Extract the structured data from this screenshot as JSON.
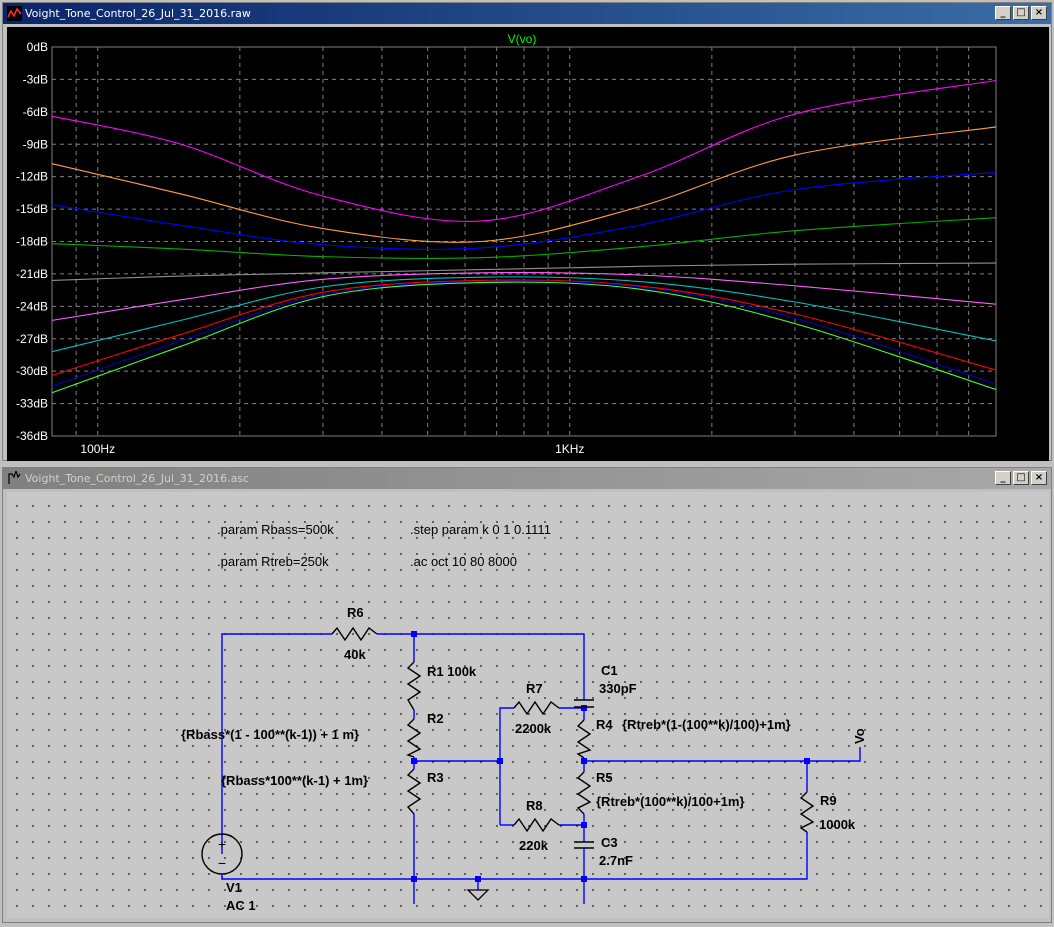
{
  "plot_window": {
    "title": "Voight_Tone_Control_26_Jul_31_2016.raw",
    "trace_label": "V(vo)",
    "buttons": [
      "_",
      "□",
      "×"
    ]
  },
  "schematic_window": {
    "title": "Voight_Tone_Control_26_Jul_31_2016.asc",
    "buttons": [
      "_",
      "□",
      "×"
    ]
  },
  "colors": {
    "plot_bg": "#000000",
    "grid": "#808080",
    "axis_text": "#ffffff",
    "trace_label": "#00ff00",
    "wire": "#0000ff"
  },
  "chart_data": {
    "type": "line",
    "title": "V(vo)",
    "x_scale": "log",
    "xlim": [
      80,
      8000
    ],
    "ylim": [
      -36,
      0
    ],
    "y_unit": "dB",
    "y_ticks": [
      "0dB",
      "-3dB",
      "-6dB",
      "-9dB",
      "-12dB",
      "-15dB",
      "-18dB",
      "-21dB",
      "-24dB",
      "-27dB",
      "-30dB",
      "-33dB",
      "-36dB"
    ],
    "x_ticks": [
      "100Hz",
      "1KHz"
    ],
    "grid": true,
    "x": [
      80,
      150,
      300,
      650,
      1400,
      3000,
      8000
    ],
    "series": [
      {
        "color": "#ff00ff",
        "values": [
          -6.4,
          -9.0,
          -13.8,
          -16.1,
          -12.0,
          -6.2,
          -3.1
        ]
      },
      {
        "color": "#ffa040",
        "values": [
          -10.8,
          -13.6,
          -16.8,
          -18.0,
          -14.8,
          -10.0,
          -7.4
        ]
      },
      {
        "color": "#0000ff",
        "values": [
          -14.6,
          -16.5,
          -18.3,
          -18.6,
          -16.5,
          -13.2,
          -11.6
        ]
      },
      {
        "color": "#00b000",
        "values": [
          -18.2,
          -18.7,
          -19.4,
          -19.5,
          -18.5,
          -17.0,
          -15.8
        ]
      },
      {
        "color": "#909090",
        "values": [
          -21.6,
          -21.2,
          -20.9,
          -20.6,
          -20.3,
          -20.1,
          -20.0
        ]
      },
      {
        "color": "#ff60ff",
        "values": [
          -25.3,
          -23.4,
          -21.5,
          -20.9,
          -21.1,
          -22.1,
          -23.8
        ]
      },
      {
        "color": "#00c0c0",
        "values": [
          -28.2,
          -25.3,
          -22.2,
          -21.3,
          -21.7,
          -23.6,
          -27.2
        ]
      },
      {
        "color": "#ff0000",
        "values": [
          -30.4,
          -26.6,
          -22.7,
          -21.6,
          -22.1,
          -24.7,
          -29.9
        ]
      },
      {
        "color": "#0000c0",
        "values": [
          -31.4,
          -27.2,
          -22.9,
          -21.7,
          -22.2,
          -25.1,
          -31.2
        ]
      },
      {
        "color": "#40ff40",
        "values": [
          -32.0,
          -27.7,
          -23.1,
          -21.8,
          -22.4,
          -25.6,
          -31.7
        ]
      }
    ]
  },
  "schematic": {
    "directives": {
      "rbass": ".param Rbass=500k",
      "rtreb": ".param Rtreb=250k",
      "step": ".step param k 0 1 0.1111",
      "ac": ".ac oct 10 80 8000"
    },
    "components": {
      "r6_name": "R6",
      "r6_value": "40k",
      "r1_label": "R1 100k",
      "r2_name": "R2",
      "r2_value": "{Rbass*(1 - 100**(k-1)) + 1 m}",
      "r3_name": "R3",
      "r3_value": "{Rbass*100**(k-1) + 1m}",
      "r7_name": "R7",
      "r7_value": "2200k",
      "r8_name": "R8",
      "r8_value": "220k",
      "c1_name": "C1",
      "c1_value": "330pF",
      "c3_name": "C3",
      "c3_value": "2.7nF",
      "r4_name": "R4",
      "r4_value": "{Rtreb*(1-(100**k)/100)+1m}",
      "r5_name": "R5",
      "r5_value": "{Rtreb*(100**k)/100+1m}",
      "r9_name": "R9",
      "r9_value": "1000k",
      "v1_name": "V1",
      "v1_value": "AC 1",
      "net_vo": "Vo"
    }
  }
}
